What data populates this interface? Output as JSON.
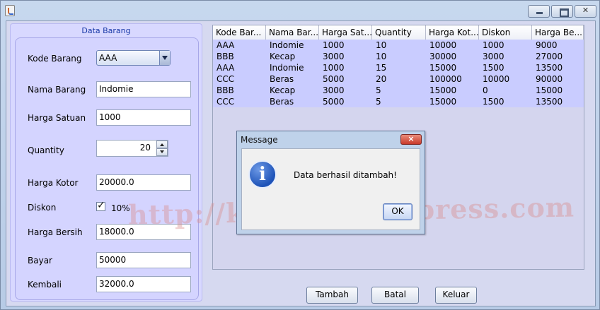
{
  "window": {
    "title": ""
  },
  "form": {
    "panel_title": "Data Barang",
    "kode_barang": {
      "label": "Kode Barang",
      "value": "AAA"
    },
    "nama_barang": {
      "label": "Nama Barang",
      "value": "Indomie"
    },
    "harga_satuan": {
      "label": "Harga Satuan",
      "value": "1000"
    },
    "quantity": {
      "label": "Quantity",
      "value": "20"
    },
    "harga_kotor": {
      "label": "Harga Kotor",
      "value": "20000.0"
    },
    "diskon": {
      "label": "Diskon",
      "checkbox_label": "10%",
      "checked": true
    },
    "harga_bersih": {
      "label": "Harga Bersih",
      "value": "18000.0"
    },
    "bayar": {
      "label": "Bayar",
      "value": "50000"
    },
    "kembali": {
      "label": "Kembali",
      "value": "32000.0"
    }
  },
  "table": {
    "columns": [
      "Kode Bar...",
      "Nama Bar...",
      "Harga Sat...",
      "Quantity",
      "Harga Kot...",
      "Diskon",
      "Harga Be..."
    ],
    "rows": [
      [
        "AAA",
        "Indomie",
        "1000",
        "10",
        "10000",
        "1000",
        "9000"
      ],
      [
        "BBB",
        "Kecap",
        "3000",
        "10",
        "30000",
        "3000",
        "27000"
      ],
      [
        "AAA",
        "Indomie",
        "1000",
        "15",
        "15000",
        "1500",
        "13500"
      ],
      [
        "CCC",
        "Beras",
        "5000",
        "20",
        "100000",
        "10000",
        "90000"
      ],
      [
        "BBB",
        "Kecap",
        "3000",
        "5",
        "15000",
        "0",
        "15000"
      ],
      [
        "CCC",
        "Beras",
        "5000",
        "5",
        "15000",
        "1500",
        "13500"
      ]
    ]
  },
  "dialog": {
    "title": "Message",
    "message": "Data berhasil ditambah!",
    "ok_label": "OK",
    "close_label": "×"
  },
  "buttons": {
    "tambah": "Tambah",
    "batal": "Batal",
    "keluar": "Keluar"
  },
  "watermark": "http://kirang.wordpress.com",
  "colors": {
    "panel_background": "#d8d8ff",
    "table_background": "#c9ccff",
    "window_background": "#c7d8ee"
  }
}
